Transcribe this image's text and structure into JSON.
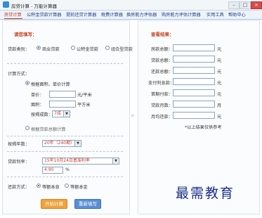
{
  "window": {
    "title": "房贷计算 - 万能计算器",
    "min": "–",
    "max": "□",
    "close": "×"
  },
  "tabs": [
    "房贷计算",
    "公积金贷款计算器",
    "提前还贷计算器",
    "税费计算器",
    "换房能力评估器",
    "购房能力评估计算器",
    "实用工具",
    "帮助中心"
  ],
  "form": {
    "section_title": "请您填写：",
    "loan_type_label": "贷款类别：",
    "loan_types": [
      "商业贷款",
      "公积金贷款",
      "组合型贷款"
    ],
    "method_label": "计算方式：",
    "method_area_option": "根据面积、单价计算",
    "unit_price_label": "单价：",
    "unit_price_unit": "元/平米",
    "area_label": "面积：",
    "area_unit": "平方米",
    "down_payment_label": "按揭成数：",
    "down_payment_value": "7成",
    "method_total_option": "根据贷款总额计算",
    "years_label": "按揭年数：",
    "years_value": "20年（240期）",
    "rate_label": "贷款利率：",
    "rate_value": "15年10月24日基准利率",
    "rate_input": "4.90",
    "rate_unit": "%",
    "repay_label": "还款方式：",
    "repay_options": [
      "等额本息",
      "等额本金"
    ],
    "start_button": "开始计算",
    "reset_button": "重新填写"
  },
  "results": {
    "section_title": "查看结果：",
    "rows": [
      {
        "label": "房款总额：",
        "unit": "元"
      },
      {
        "label": "贷款总额：",
        "unit": "元"
      },
      {
        "label": "还款总额：",
        "unit": "元"
      },
      {
        "label": "支付利息款：",
        "unit": "元"
      },
      {
        "label": "首期付款：",
        "unit": "元"
      },
      {
        "label": "贷款月数：",
        "unit": "月"
      },
      {
        "label": "月均还款：",
        "unit": "元"
      }
    ],
    "note": "*以上结果仅供参考"
  },
  "watermark": "最需教育"
}
